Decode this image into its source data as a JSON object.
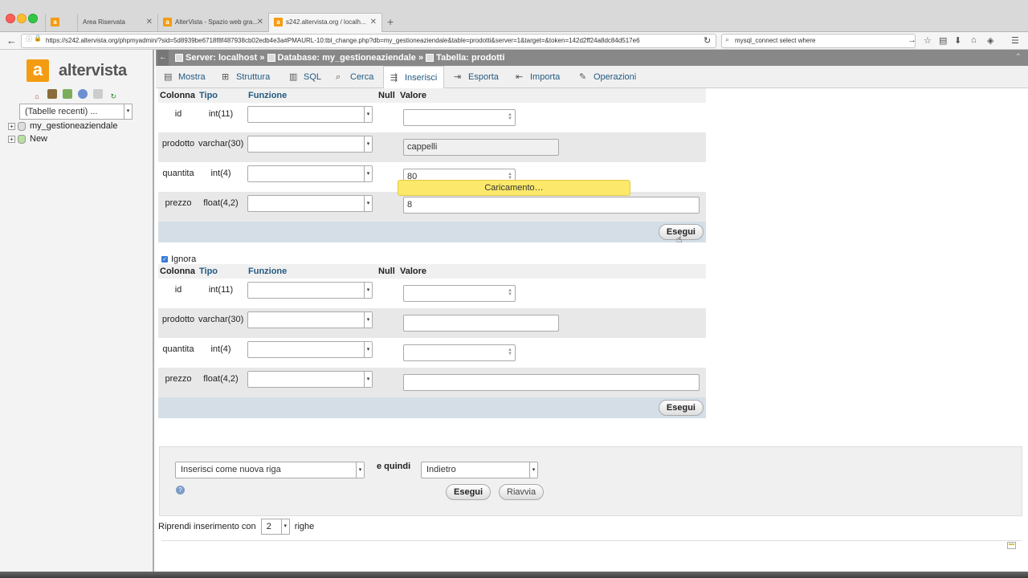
{
  "browser": {
    "tabs": [
      {
        "label": "",
        "favicon": "a"
      },
      {
        "label": "Area Riservata",
        "favicon": ""
      },
      {
        "label": "AlterVista - Spazio web gra...",
        "favicon": "a"
      },
      {
        "label": "s242.altervista.org / localh...",
        "favicon": "a"
      }
    ],
    "url": "https://s242.altervista.org/phpmyadmin/?sid=5d8939be6718f8f487938cb02edb4e3a#PMAURL-10:tbl_change.php?db=my_gestioneaziendale&table=prodotti&server=1&target=&token=142d2ff24a8dc84d517e6",
    "search": "mysql_connect select where"
  },
  "sidebar": {
    "logo_letter": "a",
    "logo_text": "altervista",
    "recent_select": "(Tabelle recenti) ...",
    "tree": [
      {
        "label": "my_gestioneaziendale"
      },
      {
        "label": "New"
      }
    ]
  },
  "breadcrumb": {
    "server": "Server: localhost",
    "database": "Database: my_gestioneaziendale",
    "table": "Tabella: prodotti",
    "sep": "»"
  },
  "tabs": [
    {
      "label": "Mostra",
      "icon": "browse-icon",
      "active": false
    },
    {
      "label": "Struttura",
      "icon": "structure-icon",
      "active": false
    },
    {
      "label": "SQL",
      "icon": "sql-icon",
      "active": false
    },
    {
      "label": "Cerca",
      "icon": "search-icon",
      "active": false
    },
    {
      "label": "Inserisci",
      "icon": "insert-icon",
      "active": true
    },
    {
      "label": "Esporta",
      "icon": "export-icon",
      "active": false
    },
    {
      "label": "Importa",
      "icon": "import-icon",
      "active": false
    },
    {
      "label": "Operazioni",
      "icon": "wrench-icon",
      "active": false
    }
  ],
  "insert_form": {
    "headers": {
      "column": "Colonna",
      "type": "Tipo",
      "function": "Funzione",
      "null": "Null",
      "value": "Valore"
    },
    "first_block": {
      "rows": [
        {
          "column": "id",
          "type": "int(11)",
          "value": ""
        },
        {
          "column": "prodotto",
          "type": "varchar(30)",
          "value": "cappelli"
        },
        {
          "column": "quantita",
          "type": "int(4)",
          "value": "80"
        },
        {
          "column": "prezzo",
          "type": "float(4,2)",
          "value": "8"
        }
      ],
      "execute_label": "Esegui"
    },
    "ignore_label": "Ignora",
    "second_block": {
      "rows": [
        {
          "column": "id",
          "type": "int(11)",
          "value": ""
        },
        {
          "column": "prodotto",
          "type": "varchar(30)",
          "value": ""
        },
        {
          "column": "quantita",
          "type": "int(4)",
          "value": ""
        },
        {
          "column": "prezzo",
          "type": "float(4,2)",
          "value": ""
        }
      ],
      "execute_label": "Esegui"
    },
    "loading_message": "Caricamento…"
  },
  "bottom_panel": {
    "insert_mode": "Inserisci come nuova riga",
    "then_label": "e quindi",
    "then_value": "Indietro",
    "execute_label": "Esegui",
    "reset_label": "Riavvia"
  },
  "resume": {
    "prefix": "Riprendi inserimento con",
    "rows": "2",
    "suffix": "righe"
  },
  "colors": {
    "accent": "#235a81",
    "logo": "#f39c12",
    "loading_bg": "#fce86a",
    "breadcrumb_bg": "#888888"
  }
}
